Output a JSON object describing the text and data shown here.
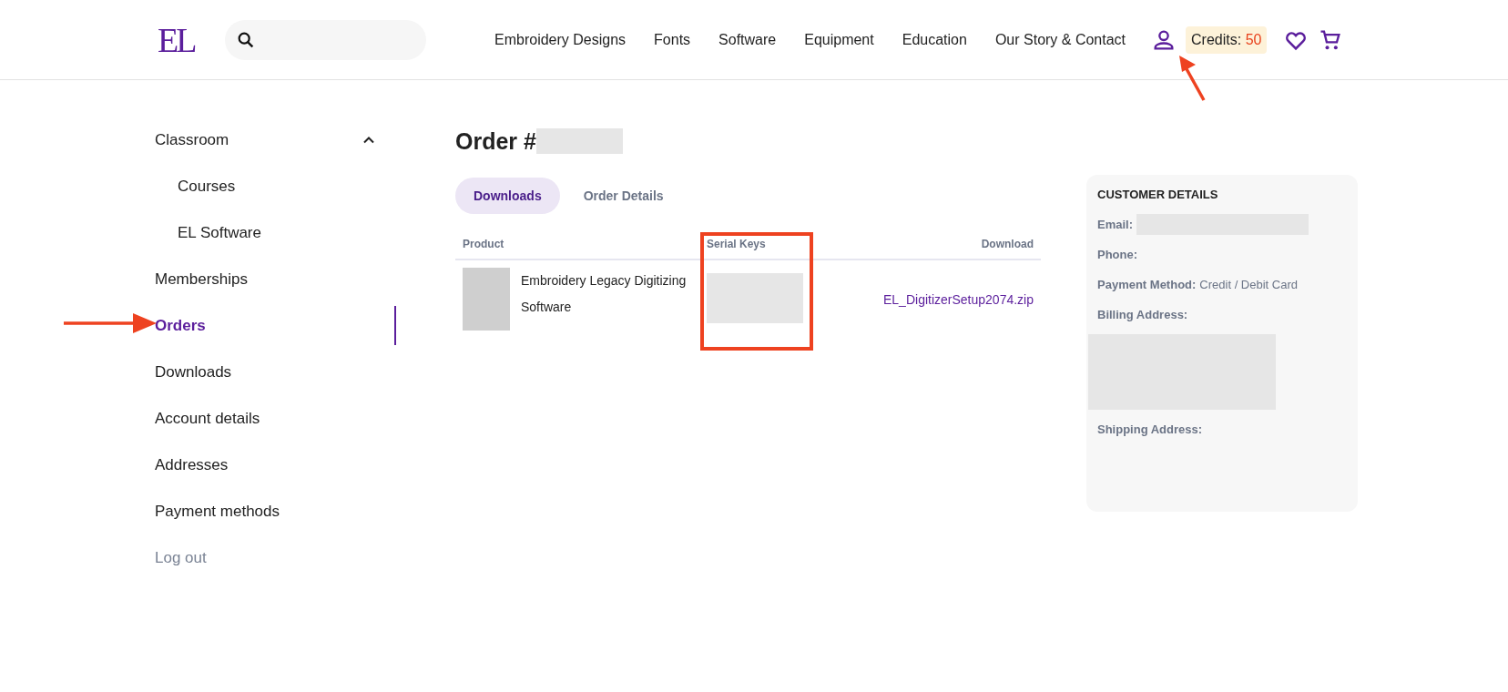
{
  "header": {
    "logo": "EL",
    "nav": [
      "Embroidery Designs",
      "Fonts",
      "Software",
      "Equipment",
      "Education",
      "Our Story & Contact"
    ],
    "credits": {
      "label": "Credits:",
      "value": "50"
    }
  },
  "sidebar": {
    "items": [
      {
        "label": "Classroom",
        "expanded": true,
        "selected": false,
        "children": [
          {
            "label": "Courses",
            "selected": false
          },
          {
            "label": "EL Software",
            "selected": false
          }
        ]
      },
      {
        "label": "Memberships",
        "selected": false
      },
      {
        "label": "Orders",
        "selected": true
      },
      {
        "label": "Downloads",
        "selected": false
      },
      {
        "label": "Account details",
        "selected": false
      },
      {
        "label": "Addresses",
        "selected": false
      },
      {
        "label": "Payment methods",
        "selected": false
      }
    ],
    "logout": "Log out"
  },
  "order": {
    "title": "Order #",
    "tabs": [
      {
        "label": "Downloads",
        "selected": true
      },
      {
        "label": "Order Details",
        "selected": false
      }
    ],
    "table": {
      "columns": [
        "Product",
        "Serial Keys",
        "Download"
      ],
      "rows": [
        {
          "product": "Embroidery Legacy Digitizing Software",
          "download": "EL_DigitizerSetup2074.zip"
        }
      ]
    }
  },
  "customer": {
    "title": "CUSTOMER DETAILS",
    "fields": [
      {
        "kind": "inline-redacted",
        "label": "Email:"
      },
      {
        "kind": "text",
        "label": "Phone:"
      },
      {
        "kind": "text",
        "label": "Payment Method:",
        "value": "Credit / Debit Card"
      },
      {
        "kind": "block-redacted",
        "label": "Billing Address:"
      },
      {
        "kind": "text",
        "label": "Shipping Address:"
      }
    ]
  }
}
